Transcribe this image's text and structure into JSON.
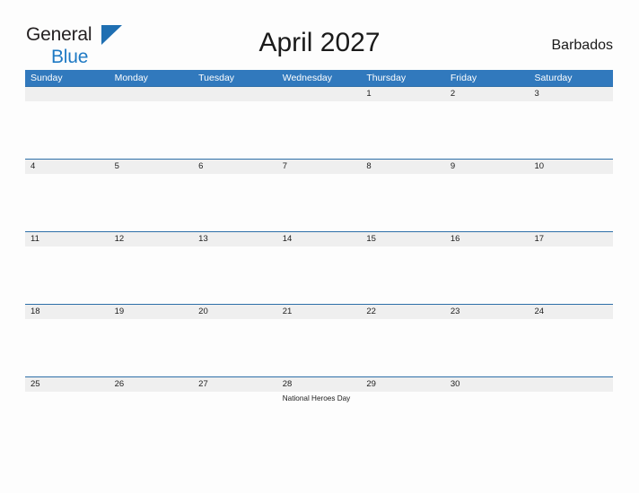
{
  "brand": {
    "line1": "General",
    "line2": "Blue",
    "triangle_color": "#1f6fb2",
    "line2_color": "#1f7ac4",
    "line1_color": "#231f20"
  },
  "header": {
    "title": "April 2027",
    "location": "Barbados"
  },
  "theme": {
    "header_blue": "#3179bd",
    "row_divider_blue": "#2e6fa8",
    "date_band_gray": "#efefef",
    "page_background": "#fdfdfd"
  },
  "calendar": {
    "weekdays": [
      "Sunday",
      "Monday",
      "Tuesday",
      "Wednesday",
      "Thursday",
      "Friday",
      "Saturday"
    ],
    "weeks": [
      {
        "days": [
          {
            "number": "",
            "event": ""
          },
          {
            "number": "",
            "event": ""
          },
          {
            "number": "",
            "event": ""
          },
          {
            "number": "",
            "event": ""
          },
          {
            "number": "1",
            "event": ""
          },
          {
            "number": "2",
            "event": ""
          },
          {
            "number": "3",
            "event": ""
          }
        ]
      },
      {
        "days": [
          {
            "number": "4",
            "event": ""
          },
          {
            "number": "5",
            "event": ""
          },
          {
            "number": "6",
            "event": ""
          },
          {
            "number": "7",
            "event": ""
          },
          {
            "number": "8",
            "event": ""
          },
          {
            "number": "9",
            "event": ""
          },
          {
            "number": "10",
            "event": ""
          }
        ]
      },
      {
        "days": [
          {
            "number": "11",
            "event": ""
          },
          {
            "number": "12",
            "event": ""
          },
          {
            "number": "13",
            "event": ""
          },
          {
            "number": "14",
            "event": ""
          },
          {
            "number": "15",
            "event": ""
          },
          {
            "number": "16",
            "event": ""
          },
          {
            "number": "17",
            "event": ""
          }
        ]
      },
      {
        "days": [
          {
            "number": "18",
            "event": ""
          },
          {
            "number": "19",
            "event": ""
          },
          {
            "number": "20",
            "event": ""
          },
          {
            "number": "21",
            "event": ""
          },
          {
            "number": "22",
            "event": ""
          },
          {
            "number": "23",
            "event": ""
          },
          {
            "number": "24",
            "event": ""
          }
        ]
      },
      {
        "days": [
          {
            "number": "25",
            "event": ""
          },
          {
            "number": "26",
            "event": ""
          },
          {
            "number": "27",
            "event": ""
          },
          {
            "number": "28",
            "event": "National Heroes Day"
          },
          {
            "number": "29",
            "event": ""
          },
          {
            "number": "30",
            "event": ""
          },
          {
            "number": "",
            "event": ""
          }
        ]
      }
    ]
  }
}
